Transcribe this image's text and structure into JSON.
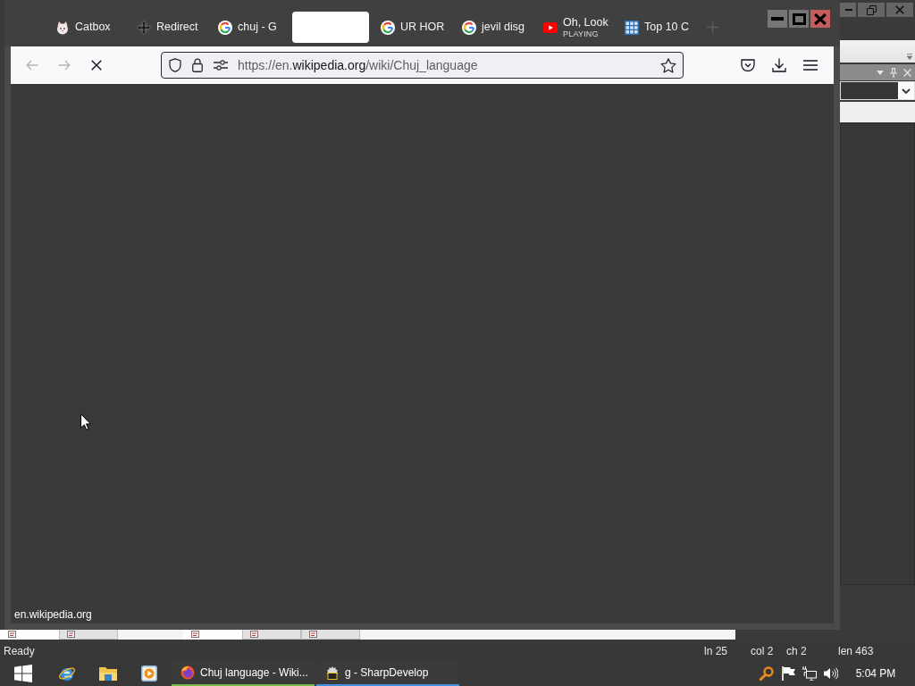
{
  "browser": {
    "window_controls": [
      {
        "kind": "minimize",
        "hovered": false
      },
      {
        "kind": "maximize",
        "hovered": false
      },
      {
        "kind": "close",
        "hovered": true
      }
    ],
    "tabs": [
      {
        "kind": "cat",
        "label": "Catbox",
        "selected": false
      },
      {
        "kind": "arrows",
        "label": "Redirect",
        "selected": false
      },
      {
        "kind": "google",
        "label": "chuj - G",
        "selected": false
      },
      {
        "selected": true
      },
      {
        "kind": "google",
        "label": "UR HOR",
        "selected": false
      },
      {
        "kind": "google",
        "label": "jevil disg",
        "selected": false
      },
      {
        "kind": "video",
        "label": "Oh, Look",
        "sublabel": "PLAYING",
        "selected": false
      },
      {
        "kind": "grid",
        "label": "Top 10 C",
        "selected": false
      }
    ],
    "nav_buttons": [
      {
        "kind": "back",
        "disabled": true
      },
      {
        "kind": "forward",
        "disabled": true
      },
      {
        "kind": "stop",
        "disabled": false
      }
    ],
    "url": "https://en.**wikipedia.org**/wiki/Chuj_language",
    "link_status": "en.wikipedia.org"
  },
  "ide": {
    "bottom_panels": [
      {
        "tabs": [
          {
            "selected": true
          },
          {
            "selected": false
          }
        ]
      },
      {
        "tabs": [
          {
            "selected": true
          },
          {
            "selected": false
          },
          {
            "selected": false
          }
        ]
      }
    ],
    "status_bar": [
      "Ready",
      "ln 25",
      "col 2",
      "ch 2",
      "len 463"
    ]
  },
  "taskbar": {
    "tasks": [
      {
        "kind": "fox",
        "label": "Chuj language - Wiki...",
        "color": "#76b947"
      },
      {
        "kind": "ide",
        "label": "g - SharpDevelop",
        "color": "#4191de"
      }
    ],
    "clock": "5:04 PM"
  }
}
